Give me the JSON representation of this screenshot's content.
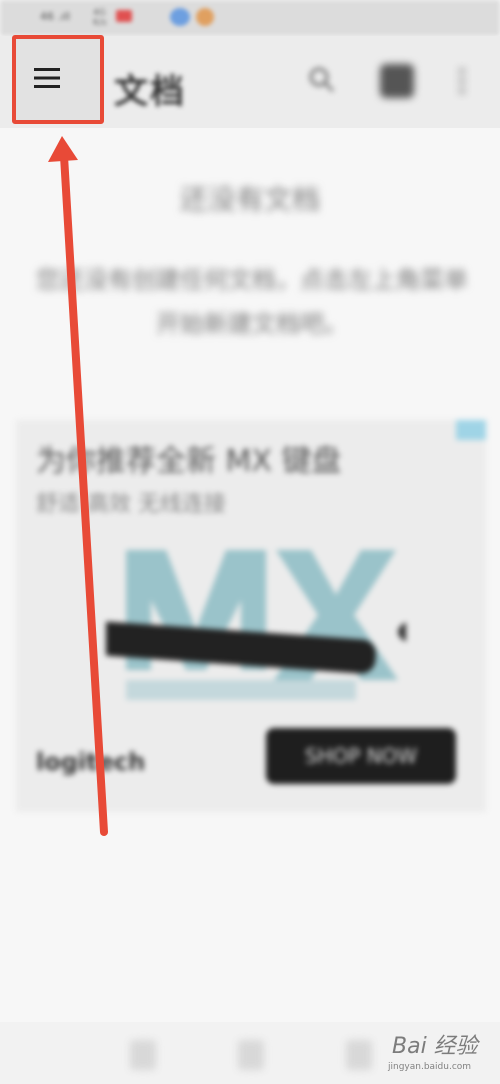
{
  "status_bar": {
    "signal_text": "46 .ıll",
    "speed": "4G\nK/s"
  },
  "app_bar": {
    "title": "文档",
    "menu_icon": "hamburger-menu-icon",
    "action_icons": [
      "search-icon",
      "folder-icon",
      "more-icon"
    ]
  },
  "content": {
    "heading": "还没有文档",
    "paragraph": "您还没有创建任何文档，点击左上角菜单开始新建文档吧。"
  },
  "ad": {
    "title": "为你推荐全新 MX 键盘",
    "subtitle": "舒适 高效 无线连接",
    "brand": "logitech",
    "cta": "SHOP NOW"
  },
  "annotation": {
    "highlight_color": "#e84a37"
  },
  "watermark": {
    "brand": "Bai 经验",
    "url": "jingyan.baidu.com"
  }
}
